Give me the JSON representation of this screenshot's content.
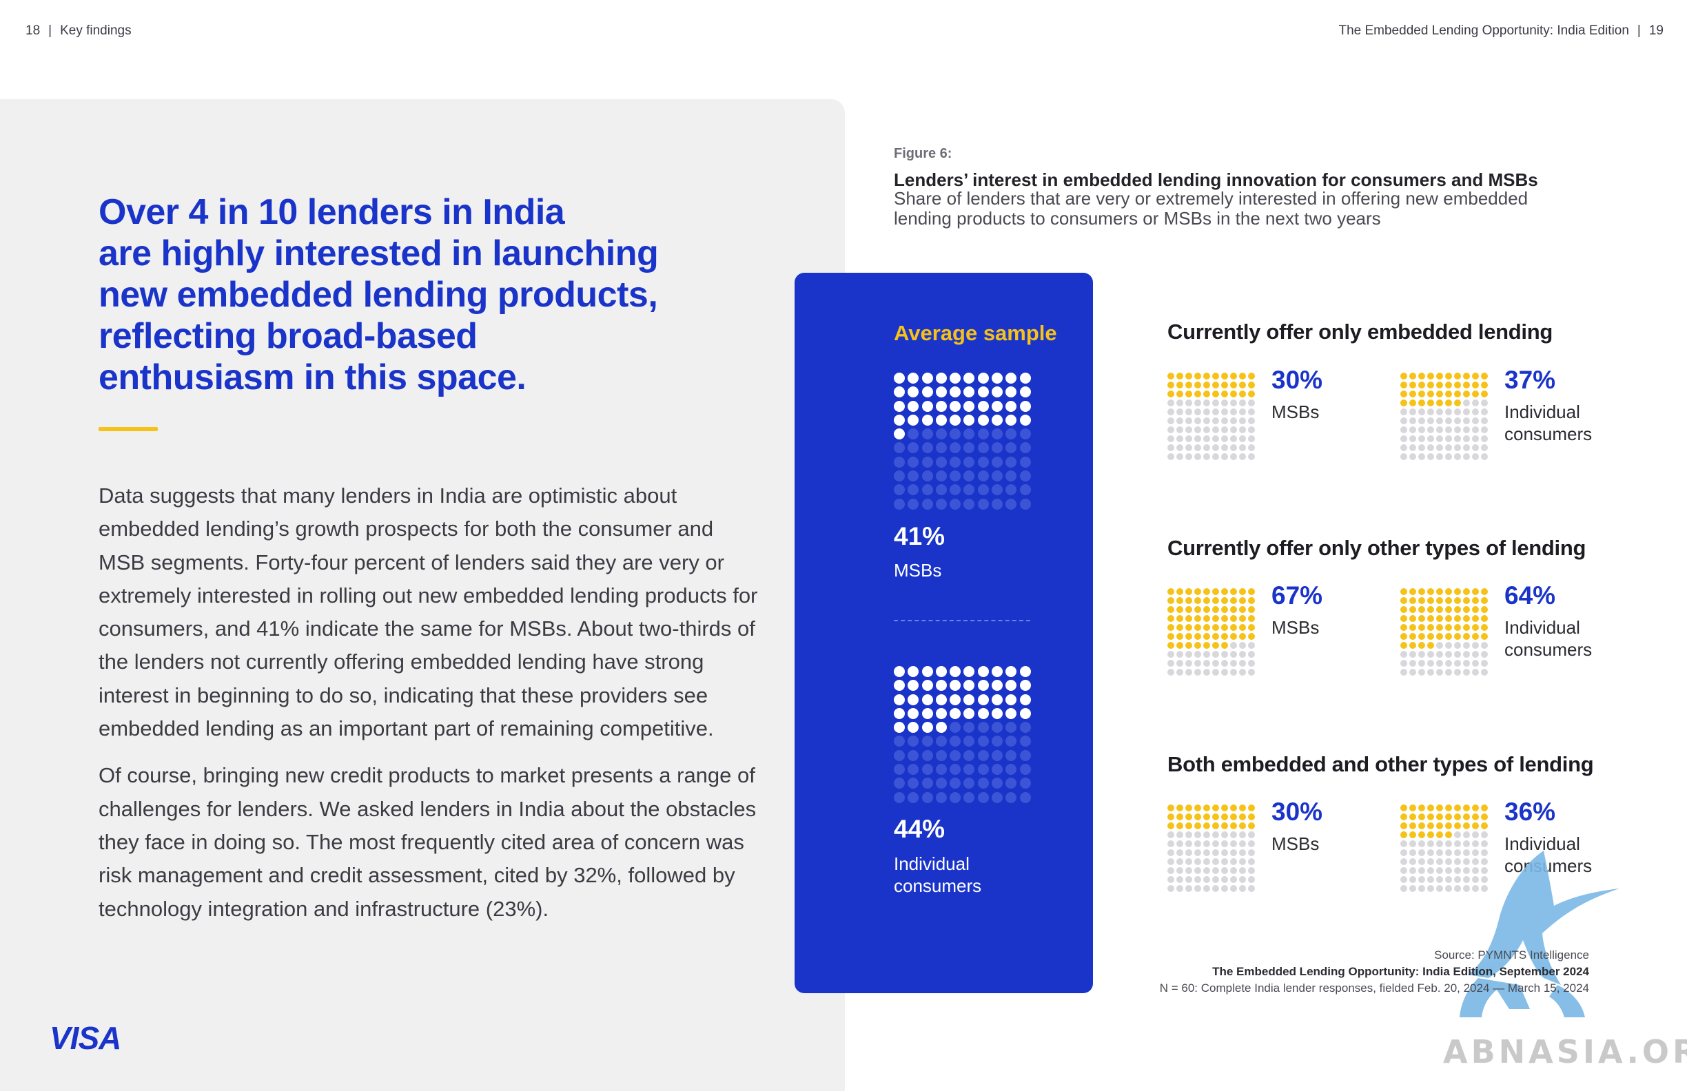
{
  "header": {
    "left_page_number": "18",
    "left_section": "Key findings",
    "right_title": "The Embedded Lending Opportunity: India Edition",
    "right_page_number": "19",
    "separator": "|"
  },
  "headline_lines": [
    "Over 4 in 10 lenders in India",
    "are highly interested in launching",
    "new embedded lending products,",
    "reflecting broad-based",
    "enthusiasm in this space."
  ],
  "body_paragraphs": [
    "Data suggests that many lenders in India are optimistic about embedded lending’s growth prospects for both the consumer and MSB segments. Forty-four percent of lenders said they are very or extremely interested in rolling out new embedded lending products for consumers, and 41% indicate the same for MSBs. About two-thirds of the lenders not currently offering embedded lending have strong interest in beginning to do so, indicating that these providers see embedded lending as an important part of remaining competitive.",
    "Of course, bringing new credit products to market presents a range of challenges for lenders. We asked lenders in India about the obstacles they face in doing so. The most frequently cited area of concern was risk management and credit assessment, cited by 32%, followed by technology integration and infrastructure (23%)."
  ],
  "logo_text": "VISA",
  "figure": {
    "label": "Figure 6:",
    "title": "Lenders’ interest in embedded lending innovation for consumers and MSBs",
    "subtitle": "Share of lenders that are very or extremely interested in offering new embedded lending products to consumers or MSBs in the next two years"
  },
  "colors": {
    "brand_blue": "#1a34c9",
    "accent_yellow": "#f6c218",
    "dot_inactive_light": "#d8d8dc",
    "dot_inactive_blue": "#3c55d6"
  },
  "chart_data": [
    {
      "type": "table",
      "title": "Average sample",
      "unit": "percent",
      "rows": [
        {
          "value": 41,
          "label": "41%",
          "segment": "MSBs"
        },
        {
          "value": 44,
          "label": "44%",
          "segment": "Individual consumers"
        }
      ]
    },
    {
      "type": "table",
      "title": "Currently offer only embedded lending",
      "unit": "percent",
      "rows": [
        {
          "value": 30,
          "label": "30%",
          "segment": "MSBs"
        },
        {
          "value": 37,
          "label": "37%",
          "segment": "Individual consumers"
        }
      ]
    },
    {
      "type": "table",
      "title": "Currently offer only other types of lending",
      "unit": "percent",
      "rows": [
        {
          "value": 67,
          "label": "67%",
          "segment": "MSBs"
        },
        {
          "value": 64,
          "label": "64%",
          "segment": "Individual consumers"
        }
      ]
    },
    {
      "type": "table",
      "title": "Both embedded and other types of lending",
      "unit": "percent",
      "rows": [
        {
          "value": 30,
          "label": "30%",
          "segment": "MSBs"
        },
        {
          "value": 36,
          "label": "36%",
          "segment": "Individual consumers"
        }
      ]
    }
  ],
  "source": {
    "line1": "Source: PYMNTS Intelligence",
    "line2": "The Embedded Lending Opportunity: India Edition, September 2024",
    "line3": "N = 60: Complete India lender responses, fielded Feb. 20, 2024 — March 15, 2024"
  },
  "watermark_text": "ABNASIA.ORG"
}
